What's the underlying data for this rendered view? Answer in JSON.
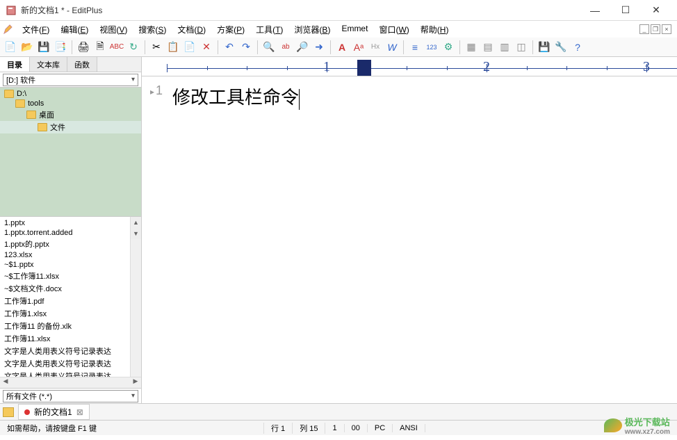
{
  "title": "新的文档1 * - EditPlus",
  "menus": [
    "文件(F)",
    "编辑(E)",
    "视图(V)",
    "搜索(S)",
    "文档(D)",
    "方案(P)",
    "工具(T)",
    "浏览器(B)",
    "Emmet",
    "窗口(W)",
    "帮助(H)"
  ],
  "side_tabs": [
    "目录",
    "文本库",
    "函数"
  ],
  "drive": "[D:] 软件",
  "tree": [
    {
      "label": "D:\\",
      "indent": 0
    },
    {
      "label": "tools",
      "indent": 1
    },
    {
      "label": "桌面",
      "indent": 2
    },
    {
      "label": "文件",
      "indent": 3,
      "selected": true
    }
  ],
  "files": [
    "1.pptx",
    "1.pptx.torrent.added",
    "1.pptx的.pptx",
    "123.xlsx",
    "~$1.pptx",
    "~$工作簿11.xlsx",
    "~$文档文件.docx",
    "工作簿1.pdf",
    "工作簿1.xlsx",
    "工作簿11 的备份.xlk",
    "工作簿11.xlsx",
    "文字是人类用表义符号记录表达",
    "文字是人类用表义符号记录表达",
    "文字是人类用表义符号记录表达"
  ],
  "filter": "所有文件 (*.*)",
  "line_number": "1",
  "editor_text": "修改工具栏命令",
  "ruler_nums": [
    "1",
    "2",
    "3"
  ],
  "doctab": {
    "name": "新的文档1"
  },
  "status": {
    "help": "如需帮助，请按键盘 F1 键",
    "line": "行 1",
    "col": "列 15",
    "sel": "1",
    "ovr": "00",
    "pc": "PC",
    "enc": "ANSI"
  },
  "watermark": {
    "text": "极光下载站",
    "url": "www.xz7.com"
  }
}
